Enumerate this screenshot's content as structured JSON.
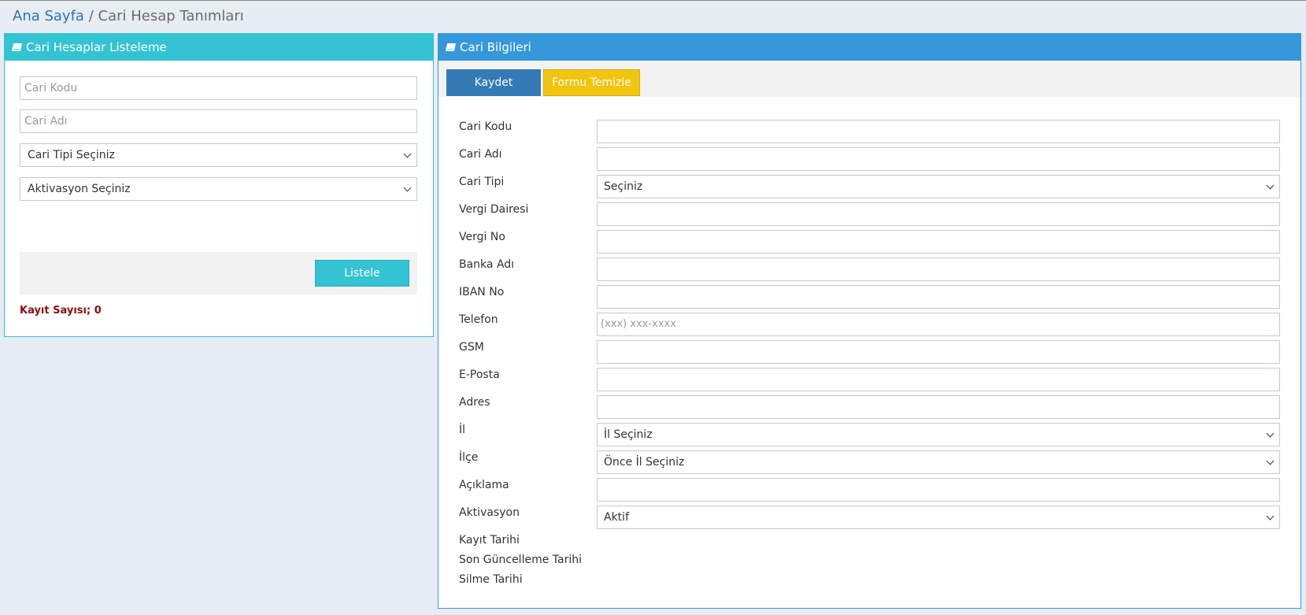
{
  "breadcrumb": {
    "home": "Ana Sayfa",
    "separator": "/",
    "current": "Cari Hesap Tanımları"
  },
  "left_panel": {
    "title": "Cari Hesaplar Listeleme",
    "icon": "book-icon",
    "filters": {
      "cari_kodu_placeholder": "Cari Kodu",
      "cari_adi_placeholder": "Cari Adı",
      "cari_tipi_selected": "Cari Tipi Seçiniz",
      "aktivasyon_selected": "Aktivasyon Seçiniz"
    },
    "list_button": "Listele",
    "record_count": "Kayıt Sayısı; 0",
    "colors": {
      "header": "#33c3d3",
      "record_count": "#8b0e0e"
    }
  },
  "right_panel": {
    "title": "Cari Bilgileri",
    "icon": "book-icon",
    "buttons": {
      "save": "Kaydet",
      "clear": "Formu Temizle"
    },
    "fields": {
      "cari_kodu": {
        "label": "Cari Kodu",
        "value": ""
      },
      "cari_adi": {
        "label": "Cari Adı",
        "value": ""
      },
      "cari_tipi": {
        "label": "Cari Tipi",
        "selected": "Seçiniz"
      },
      "vergi_dairesi": {
        "label": "Vergi Dairesi",
        "value": ""
      },
      "vergi_no": {
        "label": "Vergi No",
        "value": ""
      },
      "banka_adi": {
        "label": "Banka Adı",
        "value": ""
      },
      "iban_no": {
        "label": "IBAN No",
        "value": ""
      },
      "telefon": {
        "label": "Telefon",
        "placeholder": "(xxx) xxx-xxxx"
      },
      "gsm": {
        "label": "GSM",
        "value": ""
      },
      "eposta": {
        "label": "E-Posta",
        "value": ""
      },
      "adres": {
        "label": "Adres",
        "value": ""
      },
      "il": {
        "label": "İl",
        "selected": "İl Seçiniz"
      },
      "ilce": {
        "label": "İlçe",
        "selected": "Önce İl Seçiniz"
      },
      "aciklama": {
        "label": "Açıklama",
        "value": ""
      },
      "aktivasyon": {
        "label": "Aktivasyon",
        "selected": "Aktif"
      }
    },
    "meta_labels": {
      "kayit_tarihi": "Kayıt Tarihi",
      "son_guncelleme": "Son Güncelleme Tarihi",
      "silme_tarihi": "Silme Tarihi"
    },
    "colors": {
      "header": "#3498db",
      "save_button": "#337ab7",
      "clear_button": "#f1c40f"
    }
  }
}
